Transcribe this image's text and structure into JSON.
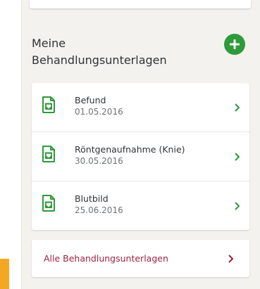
{
  "section": {
    "title_line1": "Meine",
    "title_line2": "Behandlungsunterlagen",
    "add_button_icon": "plus-icon"
  },
  "documents": [
    {
      "title": "Befund",
      "date": "01.05.2016"
    },
    {
      "title": "Röntgenaufnahme (Knie)",
      "date": "30.05.2016"
    },
    {
      "title": "Blutbild",
      "date": "25.06.2016"
    }
  ],
  "all_link": {
    "label": "Alle Behandlungsunterlagen"
  },
  "colors": {
    "accent_green": "#2e9a3a",
    "link_red": "#9a2340",
    "orange_tab": "#f5a623",
    "panel_bg": "#f3f2ef"
  },
  "icons": {
    "document": "document-heart-icon",
    "chevron": "chevron-right-icon"
  }
}
